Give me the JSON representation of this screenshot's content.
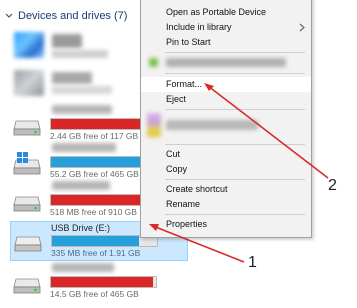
{
  "explorer": {
    "section": {
      "title": "Devices and drives (7)",
      "icon": "chevron-down-icon"
    },
    "drives": [
      {
        "id": "drive-1",
        "name": "",
        "free_text": "",
        "used_fraction": null,
        "bar_color": null,
        "obscured": true
      },
      {
        "id": "drive-2",
        "name": "",
        "free_text": "",
        "used_fraction": null,
        "bar_color": null,
        "obscured": true
      },
      {
        "id": "drive-3",
        "name": "",
        "free_text": "2.44 GB free of 117 GB",
        "used_fraction": 0.98,
        "bar_color": "#da2626",
        "obscured": false
      },
      {
        "id": "drive-4",
        "name": "",
        "free_text": "55.2 GB free of 465 GB",
        "used_fraction": 0.88,
        "bar_color": "#26a0da",
        "obscured": false
      },
      {
        "id": "drive-5",
        "name": "",
        "free_text": "518 MB free of 910 GB",
        "used_fraction": 0.99,
        "bar_color": "#da2626",
        "obscured": false
      },
      {
        "id": "drive-6",
        "name": "USB Drive (E:)",
        "free_text": "335 MB free of 1.91 GB",
        "used_fraction": 0.83,
        "bar_color": "#26a0da",
        "obscured": false,
        "selected": true
      },
      {
        "id": "drive-7",
        "name": "",
        "free_text": "14.5 GB free of 465 GB",
        "used_fraction": 0.97,
        "bar_color": "#da2626",
        "obscured": false
      }
    ]
  },
  "context_menu": {
    "items": {
      "open_portable": "Open as Portable Device",
      "include_library": "Include in library",
      "pin_start": "Pin to Start",
      "format": "Format...",
      "eject": "Eject",
      "cut": "Cut",
      "copy": "Copy",
      "create_shortcut": "Create shortcut",
      "rename": "Rename",
      "properties": "Properties"
    },
    "highlighted": "format"
  },
  "annotations": {
    "callout_1": "1",
    "callout_2": "2",
    "arrow_color": "#d92b2b"
  },
  "colors": {
    "header_text": "#1e3a78",
    "bar_blue": "#26a0da",
    "bar_red": "#da2626",
    "selection": "#cce8ff"
  }
}
